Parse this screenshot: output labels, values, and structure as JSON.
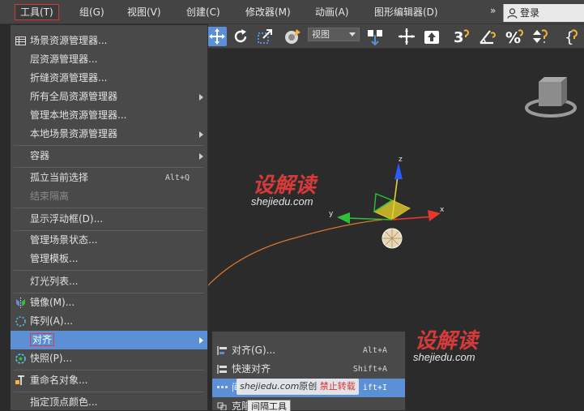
{
  "menubar": {
    "items": [
      {
        "label": "工具(T)"
      },
      {
        "label": "组(G)"
      },
      {
        "label": "视图(V)"
      },
      {
        "label": "创建(C)"
      },
      {
        "label": "修改器(M)"
      },
      {
        "label": "动画(A)"
      },
      {
        "label": "图形编辑器(D)"
      }
    ],
    "more": "»",
    "login": "登录"
  },
  "toolbar": {
    "view_dropdown": "视图"
  },
  "tools_menu": {
    "items": [
      {
        "label": "场景资源管理器..."
      },
      {
        "label": "层资源管理器..."
      },
      {
        "label": "折缝资源管理器..."
      },
      {
        "label": "所有全局资源管理器"
      },
      {
        "label": "管理本地资源管理器..."
      },
      {
        "label": "本地场景资源管理器"
      },
      {
        "label": "容器"
      },
      {
        "label": "孤立当前选择",
        "shortcut": "Alt+Q"
      },
      {
        "label": "结束隔离"
      },
      {
        "label": "显示浮动框(D)..."
      },
      {
        "label": "管理场景状态..."
      },
      {
        "label": "管理模板..."
      },
      {
        "label": "灯光列表..."
      },
      {
        "label": "镜像(M)..."
      },
      {
        "label": "阵列(A)..."
      },
      {
        "label": "对齐"
      },
      {
        "label": "快照(P)..."
      },
      {
        "label": "重命名对象..."
      },
      {
        "label": "指定顶点颜色..."
      }
    ]
  },
  "align_submenu": {
    "items": [
      {
        "label": "对齐(G)...",
        "shortcut": "Alt+A"
      },
      {
        "label": "快速对齐",
        "shortcut": "Shift+A"
      },
      {
        "label": "间",
        "shortcut": "ift+I"
      },
      {
        "label": "克隆"
      }
    ],
    "tooltip": "间隔工具"
  },
  "watermark": {
    "logo": "设解读",
    "url": "shejiedu.com",
    "banner_site": "shejiedu.com",
    "banner_orig": "原创",
    "banner_warn": "禁止转载"
  },
  "viewport": {
    "axis_x": "x",
    "axis_y": "y",
    "axis_z": "z"
  },
  "colors": {
    "highlight": "#5b8fd6",
    "red_outline": "#e33b3b",
    "axis_x": "#e53a2b",
    "axis_y": "#2fbf3a",
    "axis_z": "#2a5bff"
  }
}
